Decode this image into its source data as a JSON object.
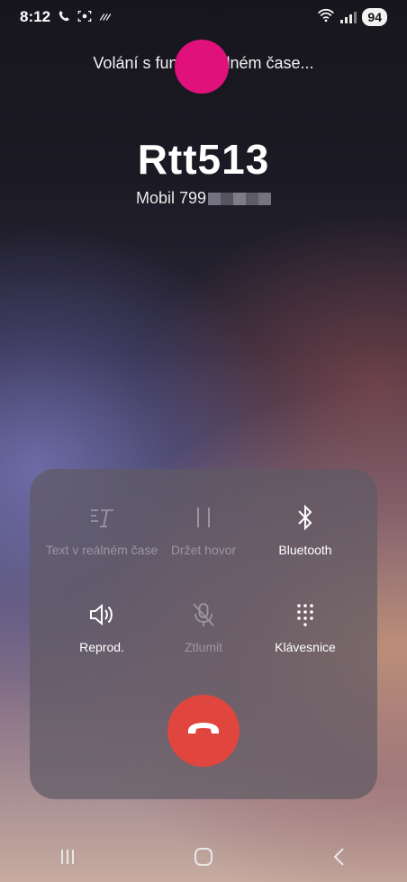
{
  "status_bar": {
    "time": "8:12",
    "battery": "94",
    "left_icons": [
      "phone-icon",
      "screenshot-icon",
      "nfc-icon"
    ],
    "right_icons": [
      "wifi-icon",
      "signal-icon"
    ]
  },
  "call": {
    "rtt_status": "Volání s funkcí     reálném čase...",
    "caller_name": "Rtt513",
    "caller_type": "Mobil",
    "caller_number": "799"
  },
  "controls": {
    "rtt": {
      "label": "Text v reálném čase",
      "icon": "rtt-icon",
      "enabled": false
    },
    "hold": {
      "label": "Držet hovor",
      "icon": "pause-icon",
      "enabled": false
    },
    "bluetooth": {
      "label": "Bluetooth",
      "icon": "bluetooth-icon",
      "enabled": true
    },
    "speaker": {
      "label": "Reprod.",
      "icon": "speaker-icon",
      "enabled": true
    },
    "mute": {
      "label": "Ztlumit",
      "icon": "mute-icon",
      "enabled": false
    },
    "keypad": {
      "label": "Klávesnice",
      "icon": "keypad-icon",
      "enabled": true
    },
    "end_call": {
      "icon": "end-call-icon",
      "color": "#e1463e"
    }
  },
  "navigation": {
    "recents": "recents-icon",
    "home": "home-icon",
    "back": "back-icon"
  }
}
